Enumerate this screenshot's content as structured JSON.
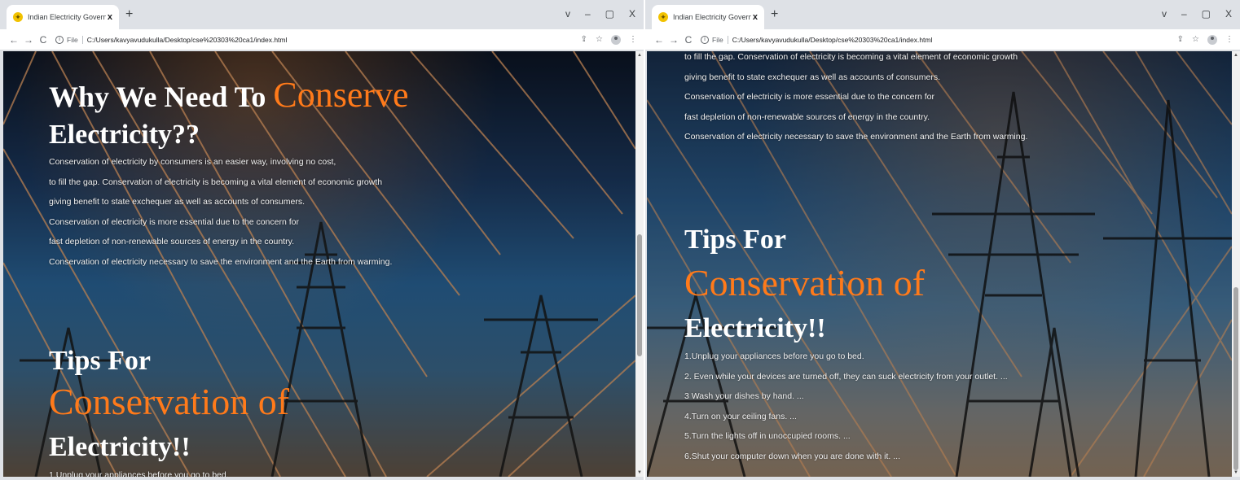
{
  "browser": {
    "tab_title": "Indian Electricity Governament of",
    "tab_close": "x",
    "new_tab": "+",
    "window_controls": [
      "v",
      "–",
      "▢",
      "X"
    ],
    "nav": {
      "back": "←",
      "forward": "→",
      "reload": "C"
    },
    "address": {
      "scheme_label": "File",
      "url": "C:/Users/kavyavudukulla/Desktop/cse%20303%20ca1/index.html"
    },
    "icons": [
      "share-icon",
      "star-icon",
      "profile-icon",
      "menu-icon"
    ]
  },
  "page": {
    "why": {
      "prefix": "Why We Need To",
      "highlight": "Conserve",
      "suffix": "Electricity??"
    },
    "why_lines": [
      "Conservation of electricity by consumers is an easier way, involving no cost,",
      "to fill the gap. Conservation of electricity is becoming a vital element of economic growth",
      "giving benefit to state exchequer as well as accounts of consumers.",
      "Conservation of electricity is more essential due to the concern for",
      "fast depletion of non-renewable sources of energy in the country.",
      "Conservation of electricity necessary to save the environment and the Earth from warming."
    ],
    "tips": {
      "prefix": "Tips For",
      "highlight": "Conservation of",
      "suffix": "Electricity!!"
    },
    "tips_lines": [
      "1.Unplug your appliances before you go to bed.",
      "2. Even while your devices are turned off, they can suck electricity from your outlet. ...",
      "3 Wash your dishes by hand. ...",
      "4.Turn on your ceiling fans. ...",
      "5.Turn the lights off in unoccupied rooms. ...",
      "6.Shut your computer down when you are done with it. ..."
    ]
  },
  "colors": {
    "accent": "#ff7a1a",
    "text": "#ffffff"
  }
}
